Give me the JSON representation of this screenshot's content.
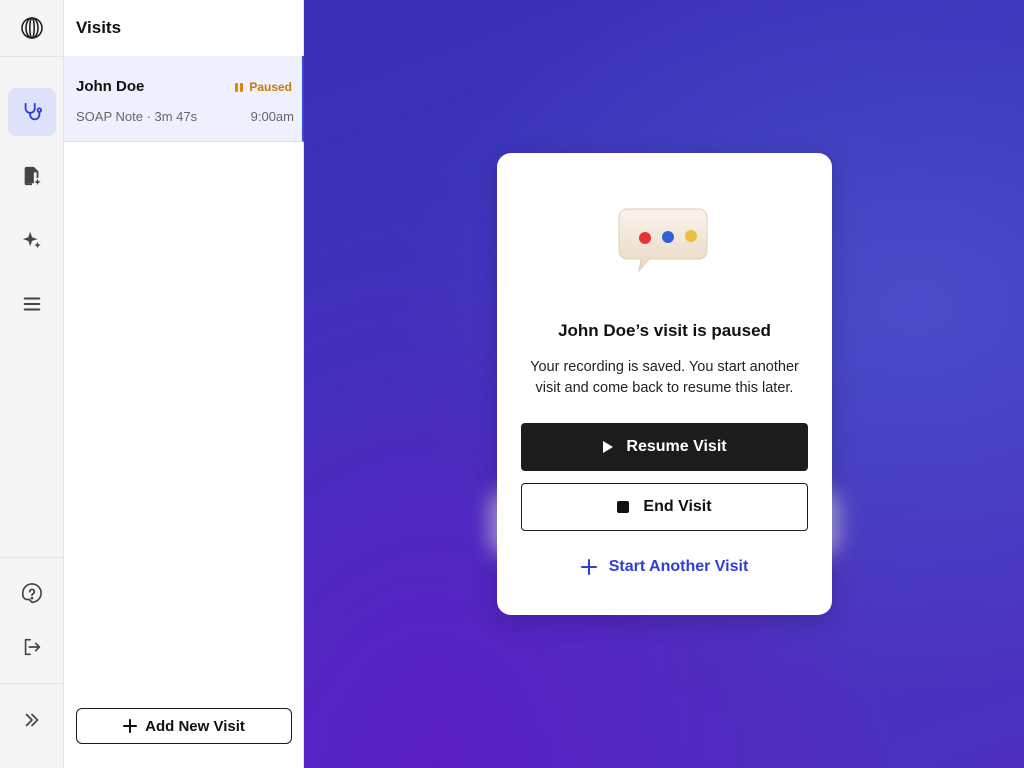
{
  "sidebar": {
    "logo_icon": "globe-logo-icon",
    "items": [
      {
        "name": "visits",
        "icon": "stethoscope-icon",
        "active": true
      },
      {
        "name": "notes",
        "icon": "document-sparkle-icon",
        "active": false
      },
      {
        "name": "ai",
        "icon": "sparkle-icon",
        "active": false
      },
      {
        "name": "menu",
        "icon": "hamburger-icon",
        "active": false
      }
    ],
    "bottom_items": [
      {
        "name": "help",
        "icon": "help-icon"
      },
      {
        "name": "logout",
        "icon": "logout-icon"
      }
    ],
    "expand_icon": "double-chevron-right-icon"
  },
  "panel": {
    "title": "Visits",
    "visits": [
      {
        "name": "John Doe",
        "status": "Paused",
        "meta": "SOAP Note · 3m 47s",
        "time": "9:00am"
      }
    ],
    "add_button": "Add New Visit"
  },
  "modal": {
    "title": "John Doe’s visit is paused",
    "body": "Your recording is saved. You start another visit and come back to resume this later.",
    "resume_label": "Resume Visit",
    "end_label": "End Visit",
    "start_label": "Start Another Visit"
  },
  "colors": {
    "accent": "#2f3fd3",
    "paused": "#c97a06",
    "background": "#3a35b9"
  }
}
